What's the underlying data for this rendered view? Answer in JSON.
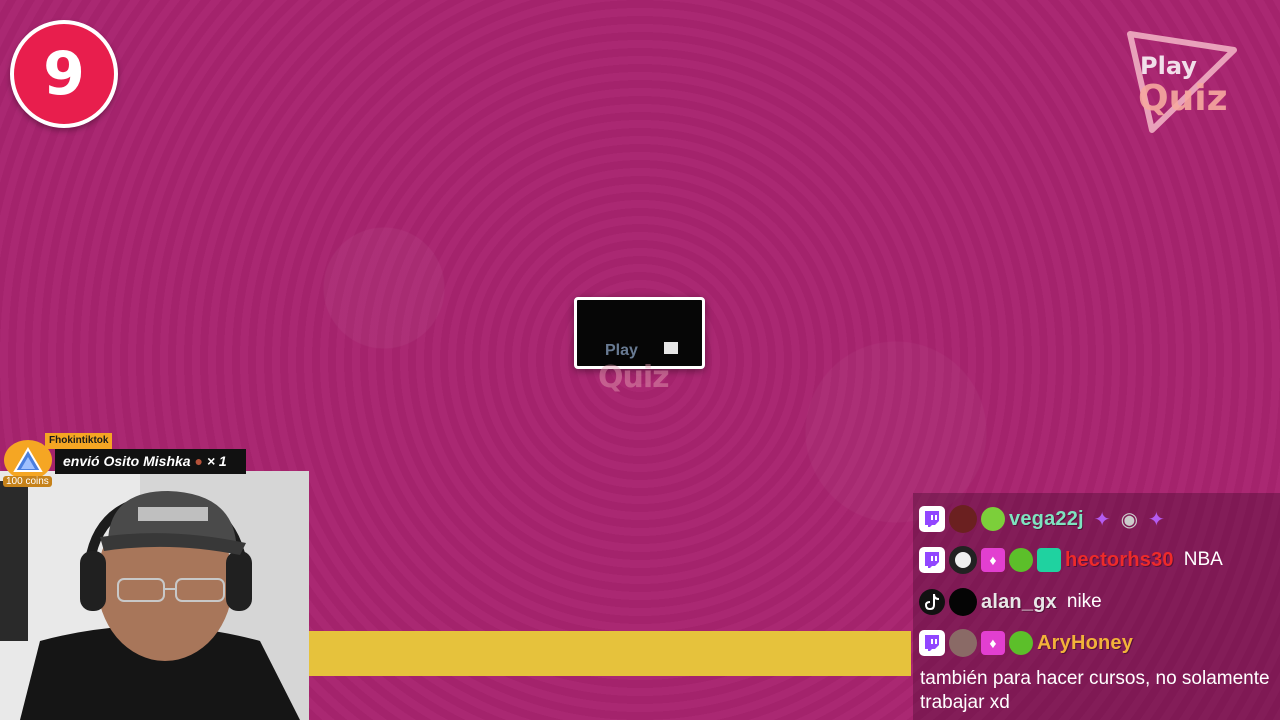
{
  "game": {
    "question_number": "9",
    "logo": {
      "line1": "Play",
      "line2": "Quiz"
    },
    "center_logo": {
      "line1": "Play",
      "line2": "Quiz"
    },
    "timer_progress": 0.62,
    "progress_color": "#e6c23c",
    "background_color": "#a8246f"
  },
  "gift_alert": {
    "sender": "Fhokintiktok",
    "message": "envió Osito Mishka",
    "count": "× 1",
    "coins": "100 coins"
  },
  "chat": {
    "messages": [
      {
        "platform": "twitch",
        "username": "vega22j",
        "color": "#7fe3c0",
        "text": "",
        "emotes": [
          "purple-hands-emote",
          "raccoon-emote",
          "purple-hands-emote"
        ]
      },
      {
        "platform": "twitch",
        "username": "hectorhs30",
        "color": "#ee2a2a",
        "text": "NBA",
        "emotes": []
      },
      {
        "platform": "tiktok",
        "username": "alan_gx",
        "color": "#e8e8e8",
        "text": "nike",
        "emotes": []
      },
      {
        "platform": "twitch",
        "username": "AryHoney",
        "color": "#f2b23a",
        "text": "también para hacer cursos, no solamente trabajar xd",
        "emotes": []
      }
    ]
  }
}
